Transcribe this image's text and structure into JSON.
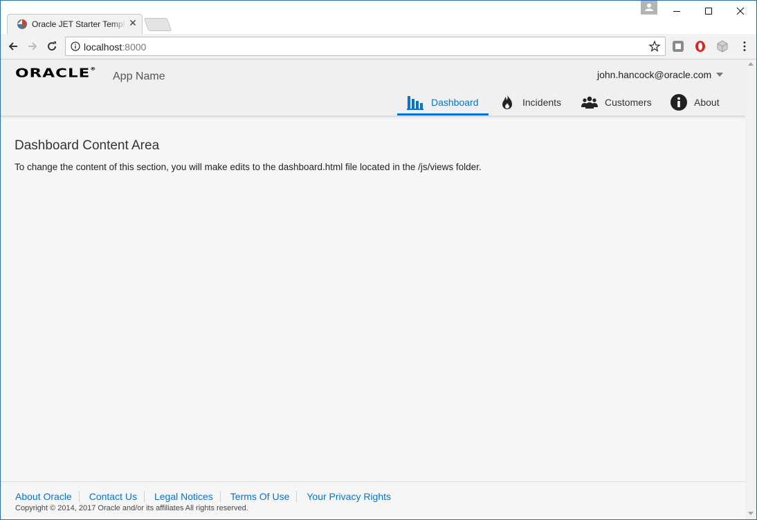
{
  "browser": {
    "tab_title": "Oracle JET Starter Template",
    "tab_close": "✕",
    "url_host": "localhost",
    "url_port": ":8000",
    "icons": [
      "back-icon",
      "forward-icon",
      "reload-icon",
      "info-icon",
      "star-icon",
      "extension-icon",
      "opera-icon",
      "cube-icon",
      "menu-dots-icon"
    ]
  },
  "header": {
    "logo": "ORACLE",
    "logo_mark": "®",
    "app_name": "App Name",
    "user": "john.hancock@oracle.com"
  },
  "nav": {
    "items": [
      {
        "label": "Dashboard",
        "icon": "bar-chart-icon",
        "active": true
      },
      {
        "label": "Incidents",
        "icon": "fire-icon",
        "active": false
      },
      {
        "label": "Customers",
        "icon": "people-icon",
        "active": false
      },
      {
        "label": "About",
        "icon": "info-circle-icon",
        "active": false
      }
    ]
  },
  "content": {
    "title": "Dashboard Content Area",
    "text": "To change the content of this section, you will make edits to the dashboard.html file located in the /js/views folder."
  },
  "footer": {
    "links": [
      "About Oracle",
      "Contact Us",
      "Legal Notices",
      "Terms Of Use",
      "Your Privacy Rights"
    ],
    "copyright": "Copyright © 2014, 2017 Oracle and/or its affiliates All rights reserved."
  },
  "colors": {
    "accent": "#0572ce",
    "header_bg": "#f0f0f0",
    "page_bg": "#f6f6f6"
  }
}
